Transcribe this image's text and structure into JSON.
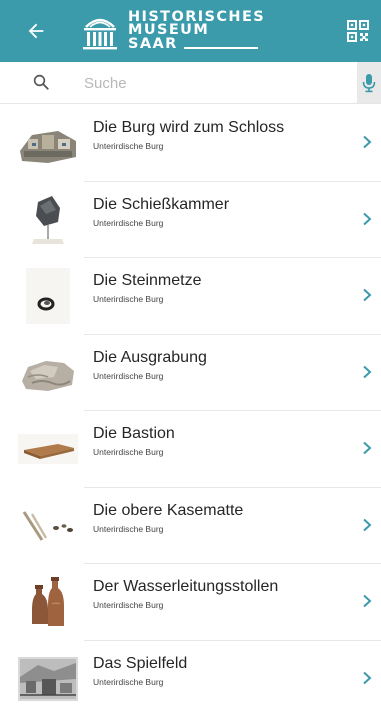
{
  "header": {
    "logo": {
      "line1": "HISTORISCHES",
      "line2": "MUSEUM",
      "line3": "SAAR"
    },
    "back_icon": "arrow-left-icon",
    "qr_icon": "qr-code-icon"
  },
  "search": {
    "placeholder": "Suche",
    "value": "",
    "search_icon": "search-icon",
    "mic_icon": "microphone-icon"
  },
  "colors": {
    "header_bg": "#3b9bab",
    "accent": "#3b9bab",
    "mic_bg": "#e9e9e9"
  },
  "items": [
    {
      "title": "Die Burg wird zum Schloss",
      "subtitle": "Unterirdische Burg",
      "thumb": "castle-model"
    },
    {
      "title": "Die Schießkammer",
      "subtitle": "Unterirdische Burg",
      "thumb": "stone-on-stand"
    },
    {
      "title": "Die Steinmetze",
      "subtitle": "Unterirdische Burg",
      "thumb": "ring"
    },
    {
      "title": "Die Ausgrabung",
      "subtitle": "Unterirdische Burg",
      "thumb": "stone-fragment"
    },
    {
      "title": "Die Bastion",
      "subtitle": "Unterirdische Burg",
      "thumb": "wooden-block"
    },
    {
      "title": "Die obere Kasematte",
      "subtitle": "Unterirdische Burg",
      "thumb": "bone-tools"
    },
    {
      "title": "Der Wasserleitungsstollen",
      "subtitle": "Unterirdische Burg",
      "thumb": "clay-jugs"
    },
    {
      "title": "Das Spielfeld",
      "subtitle": "Unterirdische Burg",
      "thumb": "engraving"
    }
  ]
}
